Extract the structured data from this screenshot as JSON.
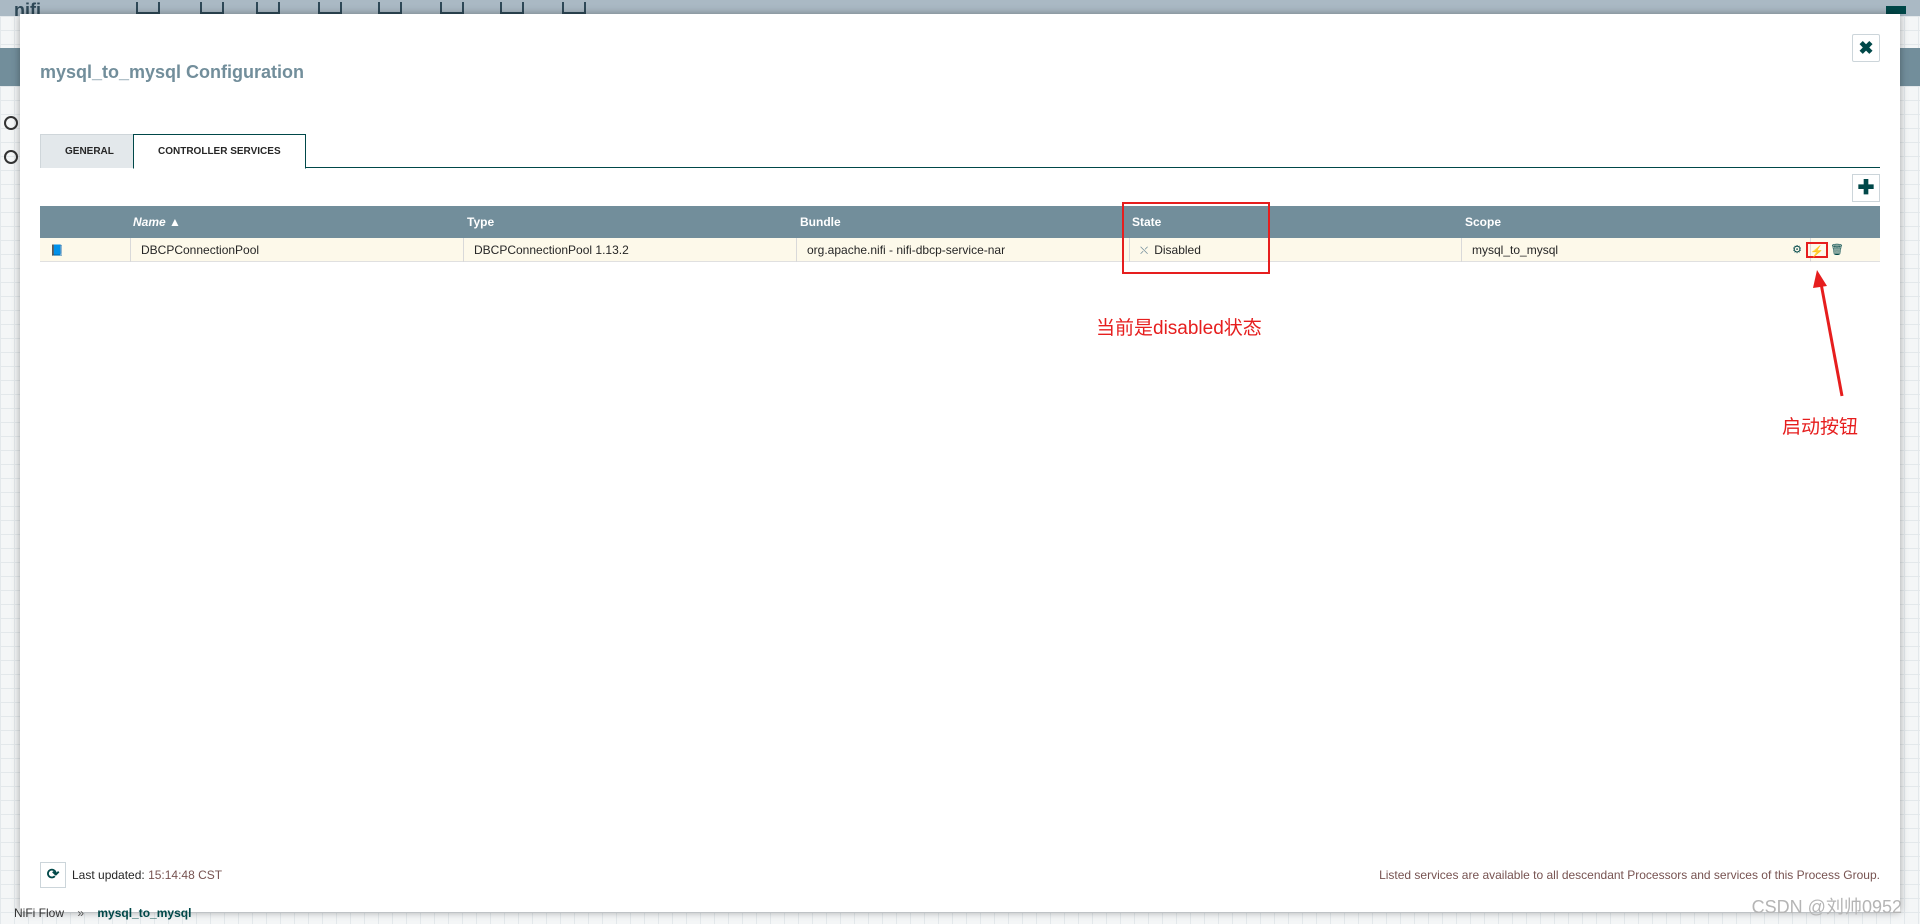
{
  "background": {
    "logo": "nifi",
    "breadcrumb": {
      "root": "NiFi Flow",
      "separator": "»",
      "current": "mysql_to_mysql"
    }
  },
  "dialog": {
    "title": "mysql_to_mysql Configuration",
    "close_icon": "close-icon",
    "close_glyph": "✖",
    "tabs": [
      {
        "label": "GENERAL"
      },
      {
        "label": "CONTROLLER SERVICES"
      }
    ],
    "add_glyph": "✚",
    "table": {
      "columns": {
        "name": "Name ▲",
        "type": "Type",
        "bundle": "Bundle",
        "state": "State",
        "scope": "Scope"
      },
      "rows": [
        {
          "doc_glyph": "📘",
          "name": "DBCPConnectionPool",
          "type": "DBCPConnectionPool 1.13.2",
          "bundle": "org.apache.nifi - nifi-dbcp-service-nar",
          "state_glyph": "⛌",
          "state": "Disabled",
          "scope": "mysql_to_mysql",
          "actions": {
            "configure_glyph": "⚙",
            "enable_glyph": "⚡",
            "delete_glyph": "🗑"
          }
        }
      ]
    },
    "footer": {
      "refresh_glyph": "⟳",
      "last_updated_label": "Last updated: ",
      "last_updated_time": "15:14:48 CST",
      "note": "Listed services are available to all descendant Processors and services of this Process Group."
    }
  },
  "annotations": {
    "state_note": "当前是disabled状态",
    "button_note": "启动按钮",
    "color": "#e61e1e"
  },
  "watermark": "CSDN @刘帅0952"
}
